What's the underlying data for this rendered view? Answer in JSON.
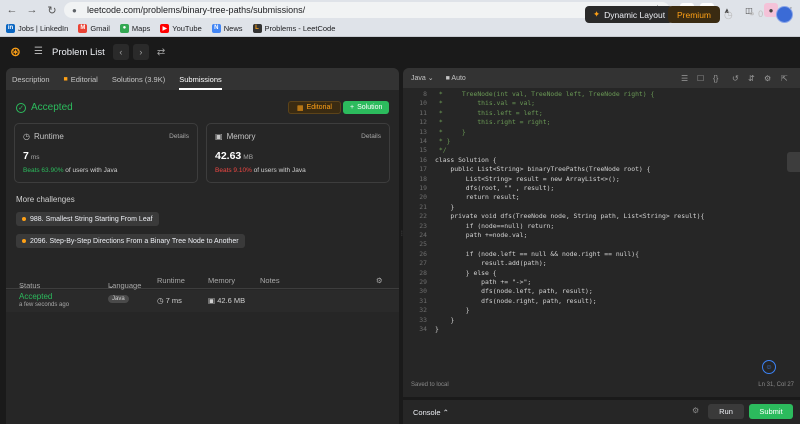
{
  "browser": {
    "url": "leetcode.com/problems/binary-tree-paths/submissions/",
    "bookmarks": [
      "Jobs | LinkedIn",
      "Gmail",
      "Maps",
      "YouTube",
      "News",
      "Problems - LeetCode"
    ]
  },
  "header": {
    "problem_list": "Problem List",
    "dynamic_layout": "Dynamic Layout",
    "premium": "Premium",
    "streak": "0"
  },
  "tabs": [
    "Description",
    "Editorial",
    "Solutions (3.9K)",
    "Submissions"
  ],
  "result": {
    "status": "Accepted",
    "editorial_btn": "Editorial",
    "solution_btn": "Solution"
  },
  "runtime": {
    "label": "Runtime",
    "details": "Details",
    "value": "7",
    "unit": "ms",
    "beats_pct": "Beats 63.90%",
    "beats_rest": "of users with Java"
  },
  "memory": {
    "label": "Memory",
    "details": "Details",
    "value": "42.63",
    "unit": "MB",
    "beats_pct": "Beats 9.10%",
    "beats_rest": "of users with Java"
  },
  "more_challenges": {
    "title": "More challenges",
    "items": [
      "988. Smallest String Starting From Leaf",
      "2096. Step-By-Step Directions From a Binary Tree Node to Another"
    ]
  },
  "table": {
    "headers": {
      "status": "Status",
      "language": "Language",
      "runtime": "Runtime",
      "memory": "Memory",
      "notes": "Notes"
    },
    "row": {
      "status": "Accepted",
      "time": "a few seconds ago",
      "language": "Java",
      "runtime": "7 ms",
      "memory": "42.6 MB"
    }
  },
  "editor": {
    "language": "Java",
    "mode": "Auto",
    "lines": [
      {
        "n": "8",
        "t": " *     TreeNode(int val, TreeNode left, TreeNode right) {"
      },
      {
        "n": "10",
        "t": " *         this.val = val;"
      },
      {
        "n": "11",
        "t": " *         this.left = left;"
      },
      {
        "n": "12",
        "t": " *         this.right = right;"
      },
      {
        "n": "13",
        "t": " *     }"
      },
      {
        "n": "14",
        "t": " * }"
      },
      {
        "n": "15",
        "t": " */"
      },
      {
        "n": "16",
        "t": "class Solution {"
      },
      {
        "n": "17",
        "t": "    public List<String> binaryTreePaths(TreeNode root) {"
      },
      {
        "n": "18",
        "t": "        List<String> result = new ArrayList<>();"
      },
      {
        "n": "19",
        "t": "        dfs(root, \"\" , result);"
      },
      {
        "n": "20",
        "t": "        return result;"
      },
      {
        "n": "21",
        "t": "    }"
      },
      {
        "n": "22",
        "t": "    private void dfs(TreeNode node, String path, List<String> result){"
      },
      {
        "n": "23",
        "t": "        if (node==null) return;"
      },
      {
        "n": "24",
        "t": "        path +=node.val;"
      },
      {
        "n": "25",
        "t": ""
      },
      {
        "n": "26",
        "t": "        if (node.left == null && node.right == null){"
      },
      {
        "n": "27",
        "t": "            result.add(path);"
      },
      {
        "n": "28",
        "t": "        } else {"
      },
      {
        "n": "29",
        "t": "            path += \"->\";"
      },
      {
        "n": "30",
        "t": "            dfs(node.left, path, result);"
      },
      {
        "n": "31",
        "t": "            dfs(node.right, path, result);"
      },
      {
        "n": "32",
        "t": "        }"
      },
      {
        "n": "33",
        "t": "    }"
      },
      {
        "n": "34",
        "t": "}"
      }
    ],
    "saved": "Saved to local",
    "cursor": "Ln 31, Col 27"
  },
  "console": {
    "label": "Console",
    "run": "Run",
    "submit": "Submit"
  }
}
